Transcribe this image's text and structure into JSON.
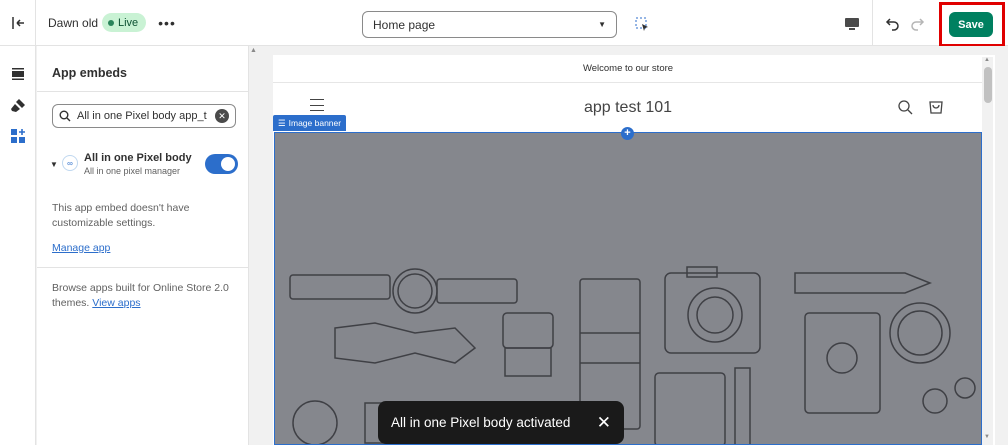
{
  "topbar": {
    "theme_name": "Dawn old",
    "live_badge": "Live",
    "more_label": "•••",
    "page_selector": "Home page",
    "save_label": "Save"
  },
  "sidebar": {
    "title": "App embeds",
    "search_value": "All in one Pixel body app_t",
    "embed": {
      "title": "All in one Pixel body",
      "subtitle": "All in one pixel manager",
      "enabled": true
    },
    "no_settings_text": "This app embed doesn't have customizable settings.",
    "manage_link": "Manage app",
    "browse_text": "Browse apps built for Online Store 2.0 themes.",
    "view_apps_link": "View apps"
  },
  "preview": {
    "announcement": "Welcome to our store",
    "store_title": "app test 101",
    "section_tag": "Image banner"
  },
  "toast": {
    "message": "All in one Pixel body activated"
  },
  "icons": {
    "exit": "exit-icon",
    "sections": "sections-icon",
    "theme_settings": "brush-icon",
    "app_embeds": "app-embeds-icon",
    "inspector": "inspector-icon",
    "device": "desktop-icon",
    "undo": "undo-icon",
    "redo": "redo-icon",
    "search": "search-icon",
    "cart": "cart-icon"
  },
  "colors": {
    "save_green": "#008060",
    "highlight_red": "#e00000",
    "accent_blue": "#2c6ecb",
    "banner_gray": "#85878d"
  }
}
